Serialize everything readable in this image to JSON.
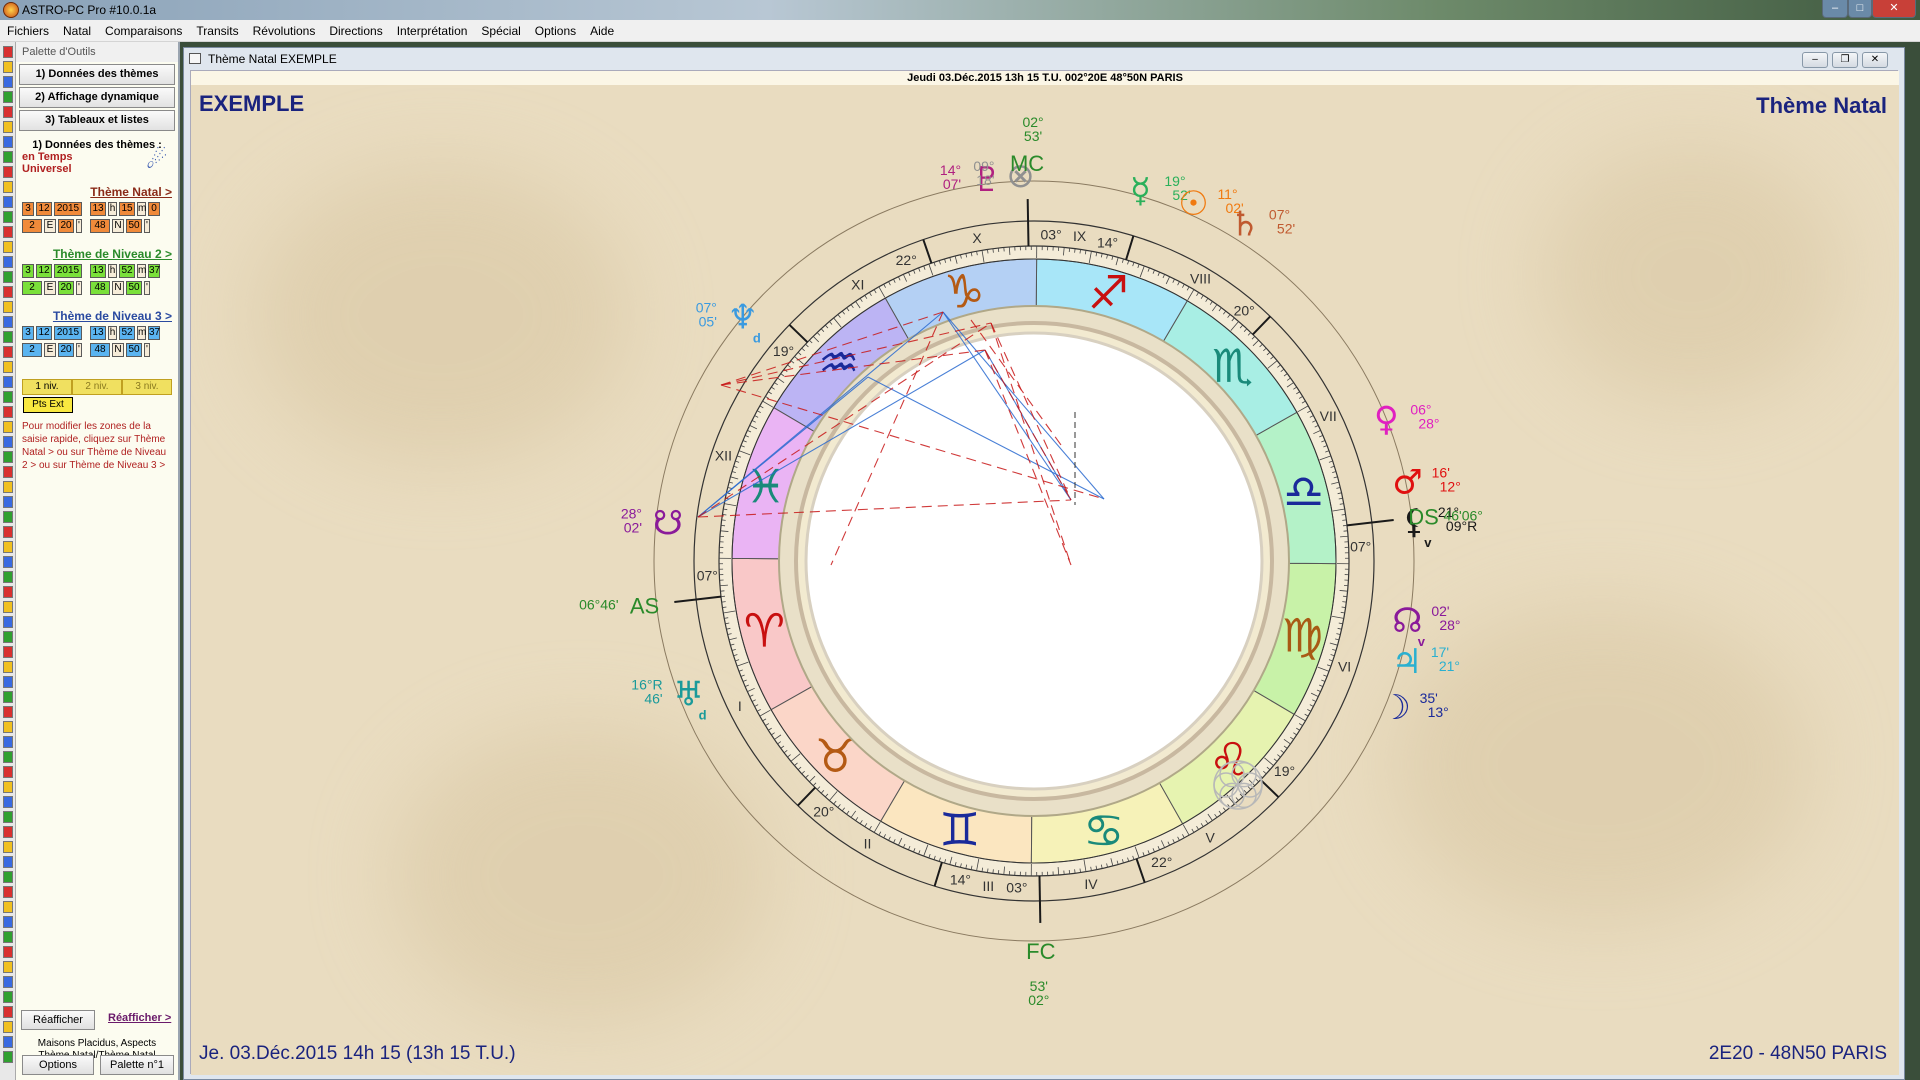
{
  "app": {
    "title": "ASTRO-PC Pro #10.0.1a"
  },
  "menu": [
    "Fichiers",
    "Natal",
    "Comparaisons",
    "Transits",
    "Révolutions",
    "Directions",
    "Interprétation",
    "Spécial",
    "Options",
    "Aide"
  ],
  "palette": {
    "header": "Palette d'Outils",
    "btn1": "1) Données des thèmes",
    "btn2": "2) Affichage dynamique",
    "btn3": "3) Tableaux et listes",
    "section": "1) Données des thèmes :",
    "tu_line1": "en Temps",
    "tu_line2": "Universel",
    "link1": "Thème Natal >",
    "link2": "Thème de Niveau 2 >",
    "link3": "Thème de Niveau 3 >",
    "t1_date": [
      "3",
      "12",
      "2015"
    ],
    "t1_time": [
      "13",
      "h",
      "15",
      "m",
      "0"
    ],
    "t1_lon": [
      "2",
      "E",
      "20",
      "'"
    ],
    "t1_lat": [
      "48",
      "N",
      "50",
      "'"
    ],
    "t2_date": [
      "3",
      "12",
      "2015"
    ],
    "t2_time": [
      "13",
      "h",
      "52",
      "m",
      "37"
    ],
    "t2_lon": [
      "2",
      "E",
      "20",
      "'"
    ],
    "t2_lat": [
      "48",
      "N",
      "50",
      "'"
    ],
    "t3_date": [
      "3",
      "12",
      "2015"
    ],
    "t3_time": [
      "13",
      "h",
      "52",
      "m",
      "37"
    ],
    "t3_lon": [
      "2",
      "E",
      "20",
      "'"
    ],
    "t3_lat": [
      "48",
      "N",
      "50",
      "'"
    ],
    "niv1": "1 niv.",
    "niv2": "2 niv.",
    "niv3": "3 niv.",
    "ptsext": "Pts Ext",
    "help": "Pour modifier les zones de la saisie rapide, cliquez sur Thème Natal > ou sur Thème de Niveau 2 > ou sur Thème de Niveau 3 >",
    "reafficher_btn": "Réafficher",
    "reafficher_link": "Réafficher >",
    "info1": "Maisons Placidus, Aspects",
    "info2": "Thème Natal/Thème Natal",
    "options_btn": "Options",
    "palette_btn": "Palette n°1"
  },
  "window": {
    "title": "Thème Natal  EXEMPLE"
  },
  "chart_header": "Jeudi 03.Déc.2015 13h 15 T.U. 002°20E 48°50N  PARIS",
  "corner": {
    "name": "EXEMPLE",
    "type": "Thème Natal",
    "bottom_left": "Je. 03.Déc.2015 14h 15 (13h 15 T.U.)",
    "bottom_right": "2E20 - 48N50  PARIS"
  },
  "colors": {
    "aries": "#f9c8c8",
    "taurus": "#fbd6c8",
    "gemini": "#fbe6c0",
    "cancer": "#f6f2b8",
    "leo": "#e6f3b0",
    "virgo": "#c8f2a8",
    "libra": "#b4f2c8",
    "scorpio": "#a8eee4",
    "sagittarius": "#a8e6f8",
    "capricorn": "#b4d0f4",
    "aquarius": "#bcb4f4",
    "pisces": "#eab4f4"
  },
  "signs": [
    {
      "glyph": "♈",
      "name": "aries",
      "color": "#c81010"
    },
    {
      "glyph": "♉",
      "name": "taurus",
      "color": "#b45a14"
    },
    {
      "glyph": "♊",
      "name": "gemini",
      "color": "#1a2a9a"
    },
    {
      "glyph": "♋",
      "name": "cancer",
      "color": "#1a8a7a"
    },
    {
      "glyph": "♌",
      "name": "leo",
      "color": "#c81010"
    },
    {
      "glyph": "♍",
      "name": "virgo",
      "color": "#a85a14"
    },
    {
      "glyph": "♎",
      "name": "libra",
      "color": "#1a2a9a"
    },
    {
      "glyph": "♏",
      "name": "scorpio",
      "color": "#1a8a7a"
    },
    {
      "glyph": "♐",
      "name": "sagittarius",
      "color": "#c81010"
    },
    {
      "glyph": "♑",
      "name": "capricorn",
      "color": "#b45a14"
    },
    {
      "glyph": "♒",
      "name": "aquarius",
      "color": "#1a2a9a"
    },
    {
      "glyph": "♓",
      "name": "pisces",
      "color": "#1a8a7a"
    }
  ],
  "houses": [
    {
      "num": "I",
      "cusp": "07°"
    },
    {
      "num": "II",
      "cusp": "20°"
    },
    {
      "num": "III",
      "cusp": "14°"
    },
    {
      "num": "IV",
      "cusp": "03°"
    },
    {
      "num": "V",
      "cusp": "22°"
    },
    {
      "num": "VI",
      "cusp": "19°"
    },
    {
      "num": "VII",
      "cusp": "07°"
    },
    {
      "num": "VIII",
      "cusp": "20°"
    },
    {
      "num": "IX",
      "cusp": "14°"
    },
    {
      "num": "X",
      "cusp": "03°"
    },
    {
      "num": "XI",
      "cusp": "22°"
    },
    {
      "num": "XII",
      "cusp": "19°"
    }
  ],
  "points": [
    {
      "glyph": "MC",
      "deg": "02°",
      "min": "53'",
      "color": "#2a8a2a"
    },
    {
      "glyph": "AS",
      "deg": "06°",
      "min": "46'",
      "color": "#2a8a2a"
    },
    {
      "glyph": "DS",
      "deg": "06°",
      "min": "46'",
      "color": "#2a8a2a"
    },
    {
      "glyph": "FC",
      "deg": "02°",
      "min": "53'",
      "color": "#2a8a2a"
    }
  ],
  "planets": [
    {
      "glyph": "♇",
      "deg": "14°",
      "min": "07'",
      "color": "#b02080"
    },
    {
      "glyph": "⊗",
      "deg": "09°",
      "min": "18'",
      "color": "#909090"
    },
    {
      "glyph": "☿",
      "deg": "19°",
      "min": "52'",
      "color": "#2ab05a"
    },
    {
      "glyph": "☉",
      "deg": "11°",
      "min": "02'",
      "color": "#f07a10"
    },
    {
      "glyph": "♄",
      "deg": "07°",
      "min": "52'",
      "color": "#c05a30"
    },
    {
      "glyph": "♆",
      "deg": "07°",
      "min": "05'",
      "color": "#3a9ae0",
      "suffix": "d"
    },
    {
      "glyph": "♀",
      "deg": "06°",
      "min": "28°",
      "color": "#e020c0"
    },
    {
      "glyph": "♂",
      "deg": "16'",
      "min": "12°",
      "color": "#e01010"
    },
    {
      "glyph": "⚸",
      "deg": "21°",
      "min": "09°R",
      "color": "#1a1a1a",
      "suffix": "v"
    },
    {
      "glyph": "♅",
      "deg": "16°R",
      "min": "46'",
      "color": "#1a9a9a",
      "suffix": "d"
    },
    {
      "glyph": "☊",
      "deg": "02'",
      "min": "28°",
      "color": "#8a1a9a",
      "suffix": "v"
    },
    {
      "glyph": "♃",
      "deg": "17'",
      "min": "21°",
      "color": "#2ab0d0"
    },
    {
      "glyph": "☽",
      "deg": "35'",
      "min": "13°",
      "color": "#1a2a9a"
    },
    {
      "glyph": "☋",
      "deg": "28°",
      "min": "02'",
      "color": "#8a1a9a"
    }
  ],
  "aspects": [
    {
      "type": "trine",
      "color": "#2a6ad0"
    },
    {
      "type": "square",
      "color": "#c81818"
    }
  ]
}
